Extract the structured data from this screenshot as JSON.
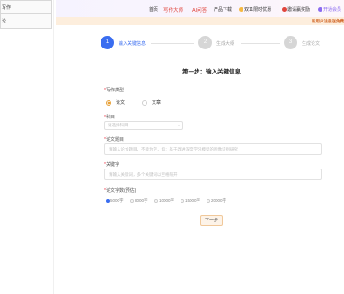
{
  "sidebar": {
    "items": [
      {
        "label": "写作"
      },
      {
        "label": "论"
      }
    ]
  },
  "nav": {
    "items": [
      {
        "label": "首页"
      },
      {
        "label": "写作大师"
      },
      {
        "label": "AI问答"
      },
      {
        "label": "产品下载"
      },
      {
        "label": "双11限时优惠"
      },
      {
        "label": "邀请赢奖励"
      },
      {
        "label": "开通会员"
      }
    ]
  },
  "promo": {
    "text": "新用户注册送免费"
  },
  "steps": [
    {
      "num": "1",
      "label": "输入关键信息",
      "active": true
    },
    {
      "num": "2",
      "label": "生成大纲",
      "active": false
    },
    {
      "num": "3",
      "label": "生成论文",
      "active": false
    }
  ],
  "form": {
    "title": "第一步：输入关键信息",
    "type_label": "写作类型",
    "type_options": [
      "论文",
      "文章"
    ],
    "subject_label": "科目",
    "subject_placeholder": "请选择科目",
    "topic_label": "论文题目",
    "topic_placeholder": "请输入论文题目，不能为空，如：基于改进深度学习模型的图像识别研究",
    "keywords_label": "关键字",
    "keywords_placeholder": "请输入关键词，多个关键词以空格隔开",
    "wordcount_label": "论文字数(预估)",
    "wordcount_options": [
      "5000字",
      "8000字",
      "10000字",
      "15000字",
      "20000字"
    ],
    "next_label": "下一步"
  },
  "colors": {
    "accent": "#3a6df0",
    "brand_red": "#e0453d",
    "button_border": "#f0c89a"
  }
}
